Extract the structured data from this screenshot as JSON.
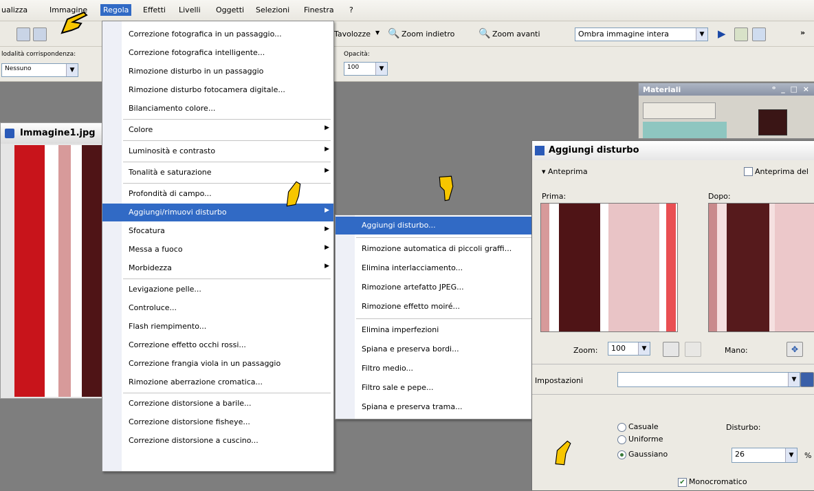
{
  "menubar": {
    "items": [
      "ualizza",
      "Immagine",
      "Regola",
      "Effetti",
      "Livelli",
      "Oggetti",
      "Selezioni",
      "Finestra",
      "?"
    ]
  },
  "toolbar": {
    "favolozze": "Tavolozze",
    "zoom_out": "Zoom indietro",
    "zoom_in": "Zoom avanti",
    "shadow_select": "Ombra immagine intera",
    "mode_label": "lodalità corrispondenza:",
    "mode_value": "Nessuno",
    "opacity_label": "Opacità:",
    "opacity_value": "100",
    "overflow": "»"
  },
  "image_window": {
    "title": "Immagine1.jpg"
  },
  "materiali": {
    "title": "Materiali",
    "window_controls": "ᵒ _ □ ×"
  },
  "regola_menu": [
    {
      "label": "Correzione fotografica in un passaggio..."
    },
    {
      "label": "Correzione fotografica intelligente..."
    },
    {
      "label": "Rimozione disturbo in un passaggio"
    },
    {
      "label": "Rimozione disturbo fotocamera digitale..."
    },
    {
      "label": "Bilanciamento colore..."
    },
    {
      "label": "Colore",
      "submenu": true
    },
    {
      "label": "Luminosità e contrasto",
      "submenu": true
    },
    {
      "label": "Tonalità e saturazione",
      "submenu": true
    },
    {
      "label": "Profondità di campo..."
    },
    {
      "label": "Aggiungi/rimuovi disturbo",
      "submenu": true,
      "highlighted": true
    },
    {
      "label": "Sfocatura",
      "submenu": true
    },
    {
      "label": "Messa a fuoco",
      "submenu": true
    },
    {
      "label": "Morbidezza",
      "submenu": true
    },
    {
      "label": "Levigazione pelle..."
    },
    {
      "label": "Controluce..."
    },
    {
      "label": "Flash riempimento..."
    },
    {
      "label": "Correzione effetto occhi rossi..."
    },
    {
      "label": "Correzione frangia viola in un passaggio"
    },
    {
      "label": "Rimozione aberrazione cromatica..."
    },
    {
      "label": "Correzione distorsione a barile..."
    },
    {
      "label": "Correzione distorsione fisheye..."
    },
    {
      "label": "Correzione distorsione a cuscino..."
    }
  ],
  "noise_submenu": [
    {
      "label": "Aggiungi disturbo...",
      "highlighted": true
    },
    {
      "label": "Rimozione automatica di piccoli graffi..."
    },
    {
      "label": "Elimina interlacciamento..."
    },
    {
      "label": "Rimozione artefatto JPEG..."
    },
    {
      "label": "Rimozione effetto moiré..."
    },
    {
      "label": "Elimina imperfezioni"
    },
    {
      "label": "Spiana e preserva bordi..."
    },
    {
      "label": "Filtro medio..."
    },
    {
      "label": "Filtro sale e pepe..."
    },
    {
      "label": "Spiana e preserva trama..."
    }
  ],
  "dialog": {
    "title": "Aggiungi disturbo",
    "preview_toggle": "Anteprima",
    "preview_on_image": "Anteprima del",
    "before_label": "Prima:",
    "after_label": "Dopo:",
    "zoom_label": "Zoom:",
    "zoom_value": "100",
    "hand_label": "Mano:",
    "settings_label": "Impostazioni",
    "radio_random": "Casuale",
    "radio_uniform": "Uniforme",
    "radio_gaussian": "Gaussiano",
    "selected_distribution": "Gaussiano",
    "noise_label": "Disturbo:",
    "noise_value": "26",
    "noise_unit": "%",
    "monochrome_label": "Monocromatico",
    "monochrome_checked": true
  },
  "colors": {
    "menu_highlight": "#316ac5",
    "stripe_red": "#c8141b",
    "stripe_pink": "#d79a9a",
    "stripe_dark": "#4f1416",
    "noise_pink": "#e9c4c6"
  }
}
